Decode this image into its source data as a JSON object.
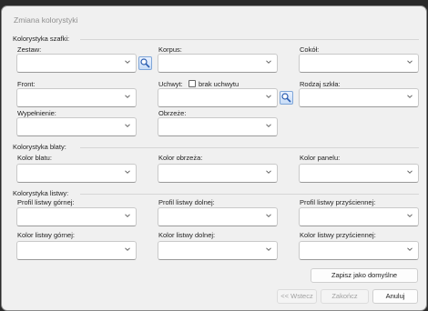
{
  "window": {
    "title": "Zmiana kolorystyki"
  },
  "cabinet": {
    "group_label": "Kolorystyka szafki:",
    "zestaw": "Zestaw:",
    "korpus": "Korpus:",
    "cokol": "Cokół:",
    "front": "Front:",
    "uchwyt": "Uchwyt:",
    "brak_uchwytu": "brak uchwytu",
    "brak_uchwytu_checked": false,
    "rodzaj_szkla": "Rodzaj szkła:",
    "wypelnienie": "Wypełnienie:",
    "obrzeze": "Obrzeże:"
  },
  "countertop": {
    "group_label": "Kolorystyka blaty:",
    "kolor_blatu": "Kolor blatu:",
    "kolor_obrzeza": "Kolor obrzeża:",
    "kolor_panelu": "Kolor panelu:"
  },
  "strip": {
    "group_label": "Kolorystyka listwy:",
    "profil_gornej": "Profil listwy górnej:",
    "profil_dolnej": "Profil listwy dolnej:",
    "profil_przysciennej": "Profil listwy przyściennej:",
    "kolor_gornej": "Kolor listwy górnej:",
    "kolor_dolnej": "Kolor listwy dolnej:",
    "kolor_przysciennej": "Kolor listwy przyściennej:"
  },
  "buttons": {
    "save_default": "Zapisz jako domyślne",
    "back": "<< Wstecz",
    "finish": "Zakończ",
    "cancel": "Anuluj"
  },
  "icons": {
    "combo_arrow": "chevron-down-icon",
    "lookup": "search-picker-icon"
  }
}
